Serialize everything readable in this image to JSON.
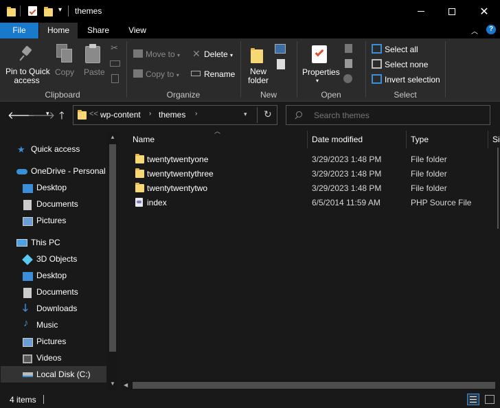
{
  "window": {
    "title": "themes"
  },
  "ribbon_tabs": {
    "file": "File",
    "home": "Home",
    "share": "Share",
    "view": "View"
  },
  "clipboard": {
    "pin": "Pin to Quick access",
    "pin_l1": "Pin to Quick",
    "pin_l2": "access",
    "copy": "Copy",
    "paste": "Paste",
    "group": "Clipboard"
  },
  "organize": {
    "move_to": "Move to",
    "copy_to": "Copy to",
    "delete": "Delete",
    "rename": "Rename",
    "group": "Organize"
  },
  "new": {
    "new_folder_l1": "New",
    "new_folder_l2": "folder",
    "group": "New"
  },
  "open": {
    "properties": "Properties",
    "group": "Open"
  },
  "select": {
    "select_all": "Select all",
    "select_none": "Select none",
    "invert": "Invert selection",
    "group": "Select"
  },
  "address": {
    "overflow": "<<",
    "crumbs": [
      "wp-content",
      "themes"
    ]
  },
  "search": {
    "placeholder": "Search themes"
  },
  "nav": {
    "quick_access": "Quick access",
    "onedrive": "OneDrive - Personal",
    "onedrive_items": [
      "Desktop",
      "Documents",
      "Pictures"
    ],
    "this_pc": "This PC",
    "pc_items": [
      "3D Objects",
      "Desktop",
      "Documents",
      "Downloads",
      "Music",
      "Pictures",
      "Videos",
      "Local Disk (C:)"
    ]
  },
  "columns": {
    "name": "Name",
    "date": "Date modified",
    "type": "Type",
    "size": "Si"
  },
  "files": [
    {
      "name": "twentytwentyone",
      "date": "3/29/2023 1:48 PM",
      "type": "File folder",
      "icon": "folder-icon"
    },
    {
      "name": "twentytwentythree",
      "date": "3/29/2023 1:48 PM",
      "type": "File folder",
      "icon": "folder-icon"
    },
    {
      "name": "twentytwentytwo",
      "date": "3/29/2023 1:48 PM",
      "type": "File folder",
      "icon": "folder-icon"
    },
    {
      "name": "index",
      "date": "6/5/2014 11:59 AM",
      "type": "PHP Source File",
      "icon": "php-file-icon"
    }
  ],
  "status": {
    "count": "4 items"
  },
  "colors": {
    "accent": "#1979ca",
    "folder": "#f8d775",
    "background": "#191919",
    "ribbon": "#2b2b2b"
  }
}
